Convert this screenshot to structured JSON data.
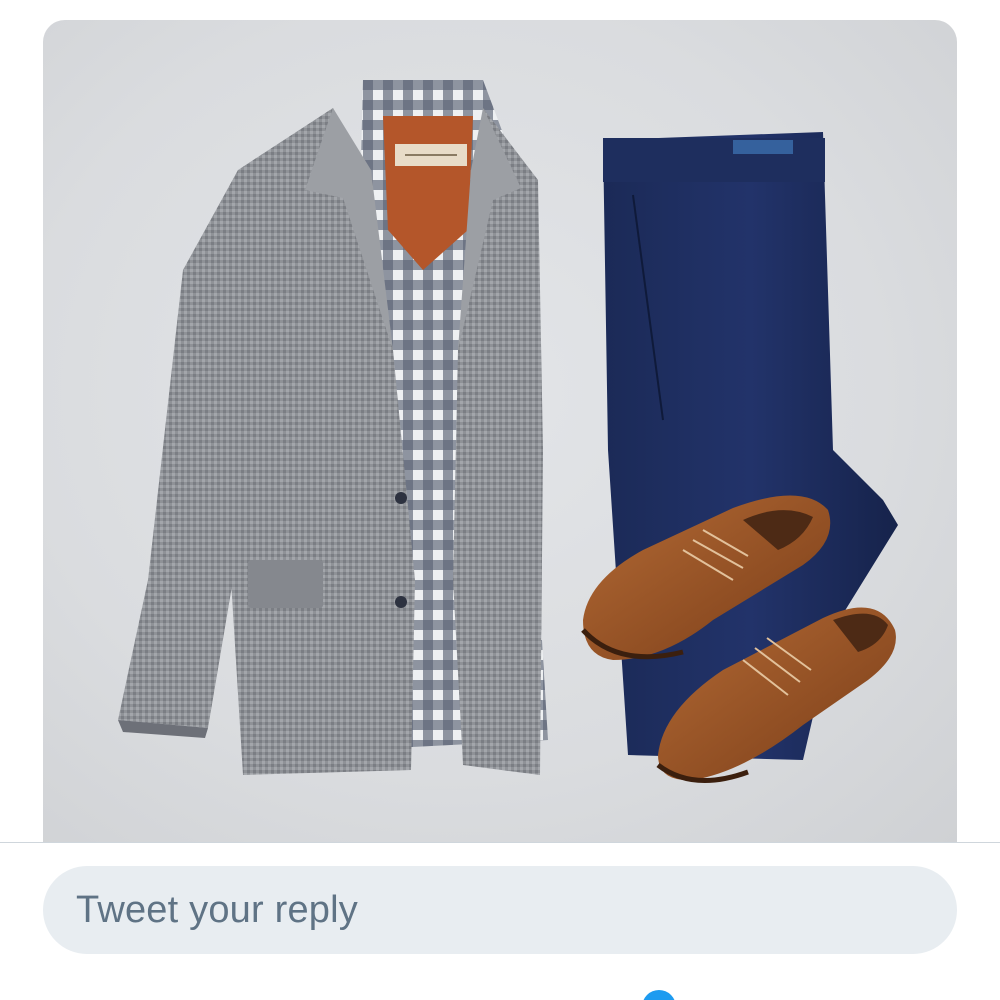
{
  "reply": {
    "placeholder": "Tweet your reply"
  },
  "colors": {
    "accent": "#1d9bf0",
    "reply_background": "#e8edf1",
    "placeholder_text": "#5f7385"
  },
  "media": {
    "description_icon": "outfit-photo"
  }
}
